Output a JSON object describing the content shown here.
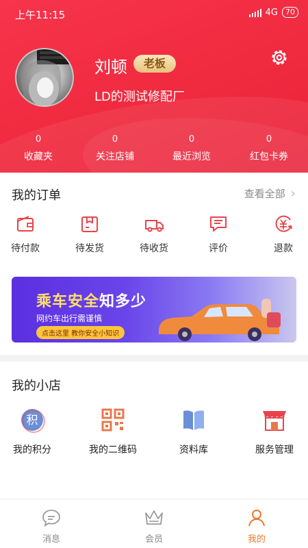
{
  "status_bar": {
    "time": "上午11:15",
    "network": "4G",
    "battery": "70"
  },
  "profile": {
    "name": "刘顿",
    "role_badge": "老板",
    "shop_name": "LD的测试修配厂"
  },
  "stats": [
    {
      "value": "0",
      "label": "收藏夹"
    },
    {
      "value": "0",
      "label": "关注店铺"
    },
    {
      "value": "0",
      "label": "最近浏览"
    },
    {
      "value": "0",
      "label": "红包卡券"
    }
  ],
  "orders": {
    "title": "我的订单",
    "view_all": "查看全部",
    "items": [
      {
        "label": "待付款",
        "icon": "wallet-icon"
      },
      {
        "label": "待发货",
        "icon": "package-icon"
      },
      {
        "label": "待收货",
        "icon": "delivery-truck-icon"
      },
      {
        "label": "评价",
        "icon": "comment-icon"
      },
      {
        "label": "退款",
        "icon": "refund-icon"
      }
    ]
  },
  "banner": {
    "title_part1": "乘车安全",
    "title_part2": "知多少",
    "subtitle": "网约车出行需谨慎",
    "button": "点击这里 教你安全小知识"
  },
  "shop": {
    "title": "我的小店",
    "items": [
      {
        "label": "我的积分",
        "icon": "points-icon"
      },
      {
        "label": "我的二维码",
        "icon": "qr-code-icon"
      },
      {
        "label": "资料库",
        "icon": "book-icon"
      },
      {
        "label": "服务管理",
        "icon": "store-icon"
      }
    ]
  },
  "tabs": [
    {
      "label": "消息",
      "icon": "message-icon"
    },
    {
      "label": "会员",
      "icon": "crown-icon"
    },
    {
      "label": "我的",
      "icon": "person-icon"
    }
  ],
  "colors": {
    "header_red": "#f02a3f",
    "accent_orange": "#e9782b",
    "icon_red": "#e8434b",
    "icon_blue": "#6b8fd6"
  }
}
